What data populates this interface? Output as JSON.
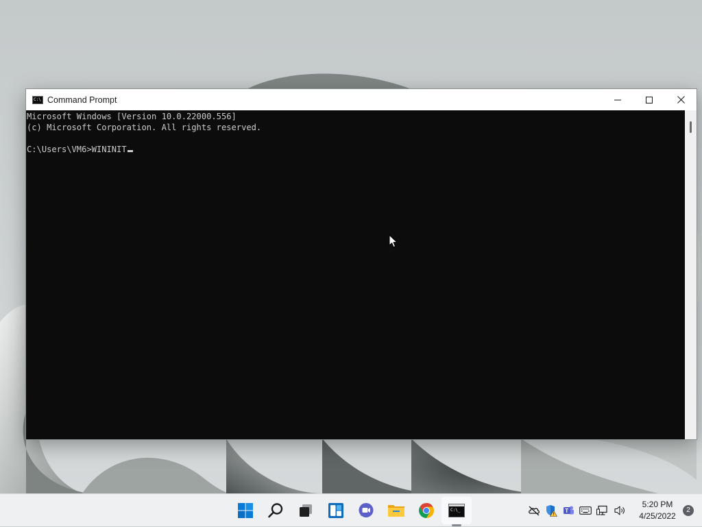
{
  "window": {
    "title": "Command Prompt",
    "app_icon_text": "C:\\",
    "minimize_label": "Minimize",
    "maximize_label": "Maximize",
    "close_label": "Close"
  },
  "console": {
    "lines": [
      "Microsoft Windows [Version 10.0.22000.556]",
      "(c) Microsoft Corporation. All rights reserved.",
      "",
      "C:\\Users\\VM6>WININIT"
    ]
  },
  "taskbar": {
    "pinned": [
      {
        "name": "start-button",
        "icon": "windows-logo-icon"
      },
      {
        "name": "search-button",
        "icon": "search-icon"
      },
      {
        "name": "task-view-button",
        "icon": "task-view-icon"
      },
      {
        "name": "widgets-button",
        "icon": "widgets-icon"
      },
      {
        "name": "chat-button",
        "icon": "teams-chat-icon"
      },
      {
        "name": "file-explorer-button",
        "icon": "folder-icon"
      },
      {
        "name": "chrome-button",
        "icon": "chrome-icon"
      },
      {
        "name": "command-prompt-button",
        "icon": "command-prompt-icon",
        "active": true
      }
    ],
    "tray": {
      "icons": [
        "onedrive-offline-icon",
        "security-warning-icon",
        "teams-icon",
        "keyboard-icon",
        "network-icon",
        "volume-icon"
      ],
      "time": "5:20 PM",
      "date": "4/25/2022",
      "notification_count": "2"
    }
  },
  "colors": {
    "console_bg": "#0c0c0c",
    "console_text": "#cccccc",
    "accent": "#0078d4"
  }
}
